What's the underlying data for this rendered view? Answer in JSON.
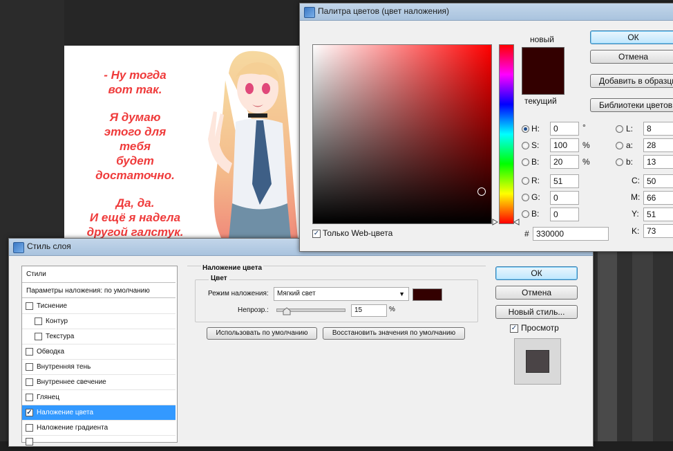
{
  "canvas": {
    "lines": [
      "- Ну тогда",
      "вот так.",
      "Я думаю",
      "этого для",
      "тебя",
      "будет",
      "достаточно.",
      "Да, да.",
      "И ещё я надела",
      "другой галстук."
    ],
    "text_color": "#ef3b3b"
  },
  "color_picker": {
    "title": "Палитра цветов (цвет наложения)",
    "new_label": "новый",
    "current_label": "текущий",
    "new_color": "#330000",
    "current_color": "#330000",
    "ok": "ОК",
    "cancel": "Отмена",
    "add_to_swatches": "Добавить в образцы",
    "color_libraries": "Библиотеки цветов",
    "only_web_colors": "Только Web-цвета",
    "only_web_checked": true,
    "fields": {
      "H": {
        "label": "H:",
        "value": "0",
        "unit": "°",
        "selected": true
      },
      "S": {
        "label": "S:",
        "value": "100",
        "unit": "%"
      },
      "Bv": {
        "label": "B:",
        "value": "20",
        "unit": "%"
      },
      "R": {
        "label": "R:",
        "value": "51"
      },
      "G": {
        "label": "G:",
        "value": "0"
      },
      "Bc": {
        "label": "B:",
        "value": "0"
      },
      "L": {
        "label": "L:",
        "value": "8"
      },
      "a": {
        "label": "a:",
        "value": "28"
      },
      "b": {
        "label": "b:",
        "value": "13"
      },
      "C": {
        "label": "C:",
        "value": "50"
      },
      "M": {
        "label": "M:",
        "value": "66"
      },
      "Y": {
        "label": "Y:",
        "value": "51"
      },
      "K": {
        "label": "K:",
        "value": "73"
      }
    },
    "hex_label": "#",
    "hex_value": "330000"
  },
  "layer_style": {
    "title": "Стиль слоя",
    "styles_header": "Стили",
    "blend_options": "Параметры наложения: по умолчанию",
    "items": [
      {
        "label": "Тиснение",
        "checked": false,
        "indent": false
      },
      {
        "label": "Контур",
        "checked": false,
        "indent": true
      },
      {
        "label": "Текстура",
        "checked": false,
        "indent": true
      },
      {
        "label": "Обводка",
        "checked": false,
        "indent": false
      },
      {
        "label": "Внутренняя тень",
        "checked": false,
        "indent": false
      },
      {
        "label": "Внутреннее свечение",
        "checked": false,
        "indent": false
      },
      {
        "label": "Глянец",
        "checked": false,
        "indent": false
      },
      {
        "label": "Наложение цвета",
        "checked": true,
        "indent": false,
        "selected": true
      },
      {
        "label": "Наложение градиента",
        "checked": false,
        "indent": false
      }
    ],
    "section_title": "Наложение цвета",
    "group_title": "Цвет",
    "blend_mode_label": "Режим наложения:",
    "blend_mode_value": "Мягкий свет",
    "overlay_color": "#330000",
    "opacity_label": "Непрозр.:",
    "opacity_value": "15",
    "opacity_unit": "%",
    "make_default": "Использовать по умолчанию",
    "reset_default": "Восстановить значения по умолчанию",
    "ok": "ОК",
    "cancel": "Отмена",
    "new_style": "Новый стиль...",
    "preview_label": "Просмотр",
    "preview_checked": true
  }
}
